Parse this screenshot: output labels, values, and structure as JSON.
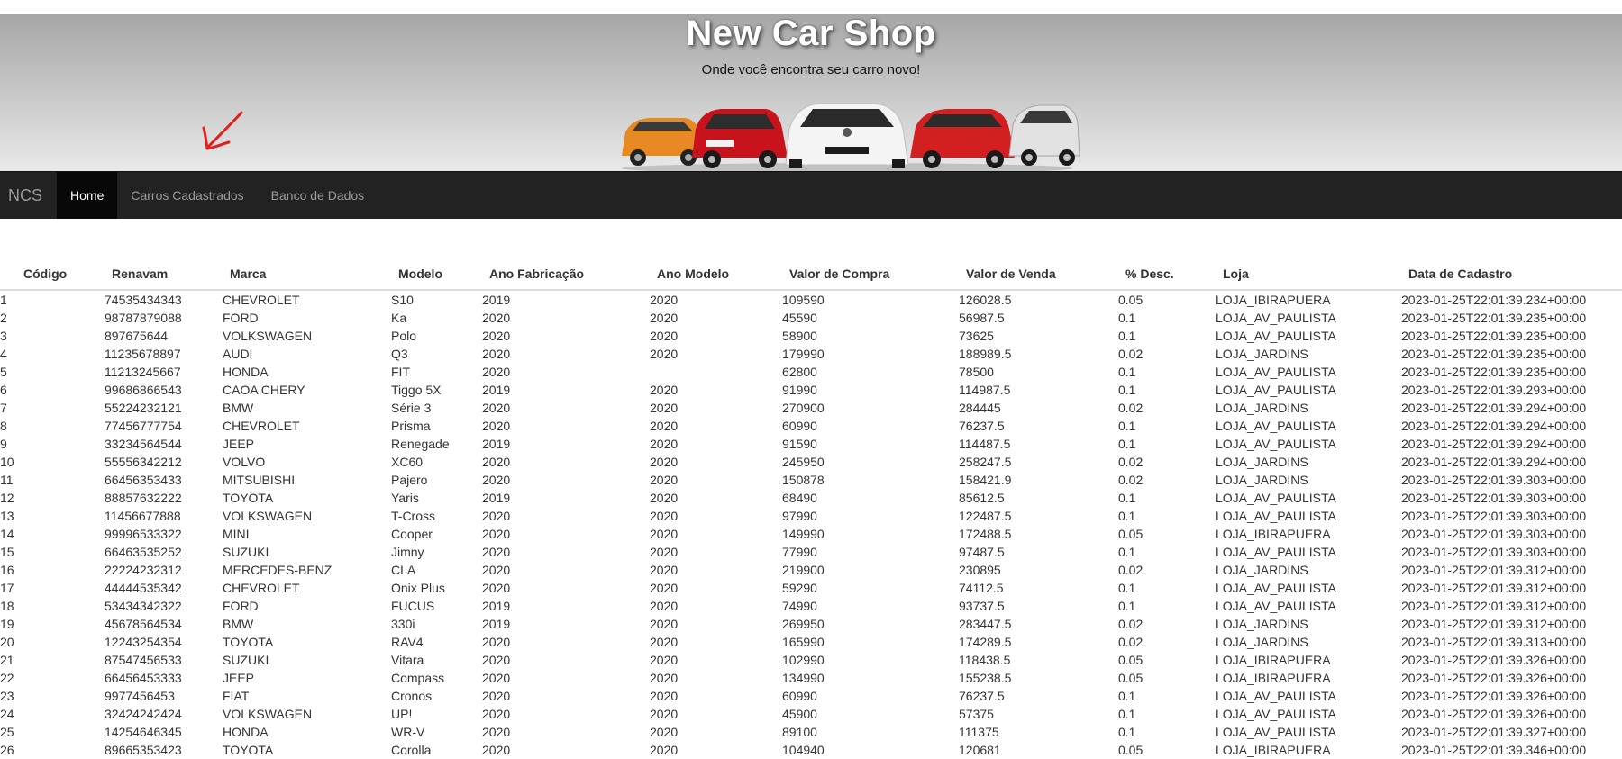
{
  "header": {
    "title": "New Car Shop",
    "subtitle": "Onde você encontra seu carro novo!"
  },
  "navbar": {
    "brand": "NCS",
    "items": [
      {
        "label": "Home",
        "active": true
      },
      {
        "label": "Carros Cadastrados",
        "active": false
      },
      {
        "label": "Banco de Dados",
        "active": false
      }
    ]
  },
  "table": {
    "columns": [
      "Código",
      "Renavam",
      "Marca",
      "Modelo",
      "Ano Fabricação",
      "Ano Modelo",
      "Valor de Compra",
      "Valor de Venda",
      "% Desc.",
      "Loja",
      "Data de Cadastro"
    ],
    "rows": [
      [
        "1",
        "74535434343",
        "CHEVROLET",
        "S10",
        "2019",
        "2020",
        "109590",
        "126028.5",
        "0.05",
        "LOJA_IBIRAPUERA",
        "2023-01-25T22:01:39.234+00:00"
      ],
      [
        "2",
        "98787879088",
        "FORD",
        "Ka",
        "2020",
        "2020",
        "45590",
        "56987.5",
        "0.1",
        "LOJA_AV_PAULISTA",
        "2023-01-25T22:01:39.235+00:00"
      ],
      [
        "3",
        "897675644",
        "VOLKSWAGEN",
        "Polo",
        "2020",
        "2020",
        "58900",
        "73625",
        "0.1",
        "LOJA_AV_PAULISTA",
        "2023-01-25T22:01:39.235+00:00"
      ],
      [
        "4",
        "11235678897",
        "AUDI",
        "Q3",
        "2020",
        "2020",
        "179990",
        "188989.5",
        "0.02",
        "LOJA_JARDINS",
        "2023-01-25T22:01:39.235+00:00"
      ],
      [
        "5",
        "11213245667",
        "HONDA",
        "FIT",
        "2020",
        "",
        "62800",
        "78500",
        "0.1",
        "LOJA_AV_PAULISTA",
        "2023-01-25T22:01:39.235+00:00"
      ],
      [
        "6",
        "99686866543",
        "CAOA CHERY",
        "Tiggo 5X",
        "2019",
        "2020",
        "91990",
        "114987.5",
        "0.1",
        "LOJA_AV_PAULISTA",
        "2023-01-25T22:01:39.293+00:00"
      ],
      [
        "7",
        "55224232121",
        "BMW",
        "Série 3",
        "2020",
        "2020",
        "270900",
        "284445",
        "0.02",
        "LOJA_JARDINS",
        "2023-01-25T22:01:39.294+00:00"
      ],
      [
        "8",
        "77456777754",
        "CHEVROLET",
        "Prisma",
        "2020",
        "2020",
        "60990",
        "76237.5",
        "0.1",
        "LOJA_AV_PAULISTA",
        "2023-01-25T22:01:39.294+00:00"
      ],
      [
        "9",
        "33234564544",
        "JEEP",
        "Renegade",
        "2019",
        "2020",
        "91590",
        "114487.5",
        "0.1",
        "LOJA_AV_PAULISTA",
        "2023-01-25T22:01:39.294+00:00"
      ],
      [
        "10",
        "55556342212",
        "VOLVO",
        "XC60",
        "2020",
        "2020",
        "245950",
        "258247.5",
        "0.02",
        "LOJA_JARDINS",
        "2023-01-25T22:01:39.294+00:00"
      ],
      [
        "11",
        "66456353433",
        "MITSUBISHI",
        "Pajero",
        "2020",
        "2020",
        "150878",
        "158421.9",
        "0.02",
        "LOJA_JARDINS",
        "2023-01-25T22:01:39.303+00:00"
      ],
      [
        "12",
        "88857632222",
        "TOYOTA",
        "Yaris",
        "2019",
        "2020",
        "68490",
        "85612.5",
        "0.1",
        "LOJA_AV_PAULISTA",
        "2023-01-25T22:01:39.303+00:00"
      ],
      [
        "13",
        "11456677888",
        "VOLKSWAGEN",
        "T-Cross",
        "2020",
        "2020",
        "97990",
        "122487.5",
        "0.1",
        "LOJA_AV_PAULISTA",
        "2023-01-25T22:01:39.303+00:00"
      ],
      [
        "14",
        "99996533322",
        "MINI",
        "Cooper",
        "2020",
        "2020",
        "149990",
        "172488.5",
        "0.05",
        "LOJA_IBIRAPUERA",
        "2023-01-25T22:01:39.303+00:00"
      ],
      [
        "15",
        "66463535252",
        "SUZUKI",
        "Jimny",
        "2020",
        "2020",
        "77990",
        "97487.5",
        "0.1",
        "LOJA_AV_PAULISTA",
        "2023-01-25T22:01:39.303+00:00"
      ],
      [
        "16",
        "22224232312",
        "MERCEDES-BENZ",
        "CLA",
        "2020",
        "2020",
        "219900",
        "230895",
        "0.02",
        "LOJA_JARDINS",
        "2023-01-25T22:01:39.312+00:00"
      ],
      [
        "17",
        "44444535342",
        "CHEVROLET",
        "Onix Plus",
        "2020",
        "2020",
        "59290",
        "74112.5",
        "0.1",
        "LOJA_AV_PAULISTA",
        "2023-01-25T22:01:39.312+00:00"
      ],
      [
        "18",
        "53434342322",
        "FORD",
        "FUCUS",
        "2019",
        "2020",
        "74990",
        "93737.5",
        "0.1",
        "LOJA_AV_PAULISTA",
        "2023-01-25T22:01:39.312+00:00"
      ],
      [
        "19",
        "45678564534",
        "BMW",
        "330i",
        "2019",
        "2020",
        "269950",
        "283447.5",
        "0.02",
        "LOJA_JARDINS",
        "2023-01-25T22:01:39.312+00:00"
      ],
      [
        "20",
        "12243254354",
        "TOYOTA",
        "RAV4",
        "2020",
        "2020",
        "165990",
        "174289.5",
        "0.02",
        "LOJA_JARDINS",
        "2023-01-25T22:01:39.313+00:00"
      ],
      [
        "21",
        "87547456533",
        "SUZUKI",
        "Vitara",
        "2020",
        "2020",
        "102990",
        "118438.5",
        "0.05",
        "LOJA_IBIRAPUERA",
        "2023-01-25T22:01:39.326+00:00"
      ],
      [
        "22",
        "66456453333",
        "JEEP",
        "Compass",
        "2020",
        "2020",
        "134990",
        "155238.5",
        "0.05",
        "LOJA_IBIRAPUERA",
        "2023-01-25T22:01:39.326+00:00"
      ],
      [
        "23",
        "9977456453",
        "FIAT",
        "Cronos",
        "2020",
        "2020",
        "60990",
        "76237.5",
        "0.1",
        "LOJA_AV_PAULISTA",
        "2023-01-25T22:01:39.326+00:00"
      ],
      [
        "24",
        "32424242424",
        "VOLKSWAGEN",
        "UP!",
        "2020",
        "2020",
        "45900",
        "57375",
        "0.1",
        "LOJA_AV_PAULISTA",
        "2023-01-25T22:01:39.326+00:00"
      ],
      [
        "25",
        "14254646345",
        "HONDA",
        "WR-V",
        "2020",
        "2020",
        "89100",
        "111375",
        "0.1",
        "LOJA_AV_PAULISTA",
        "2023-01-25T22:01:39.327+00:00"
      ],
      [
        "26",
        "89665353423",
        "TOYOTA",
        "Corolla",
        "2020",
        "2020",
        "104940",
        "120681",
        "0.05",
        "LOJA_IBIRAPUERA",
        "2023-01-25T22:01:39.346+00:00"
      ]
    ]
  },
  "colors": {
    "navbar_bg": "#222222",
    "nav_active_bg": "#080808",
    "annotation": "#e02020"
  },
  "icons": {
    "annotation": "red-arrow-annotation",
    "banner": "car-lineup-image"
  }
}
